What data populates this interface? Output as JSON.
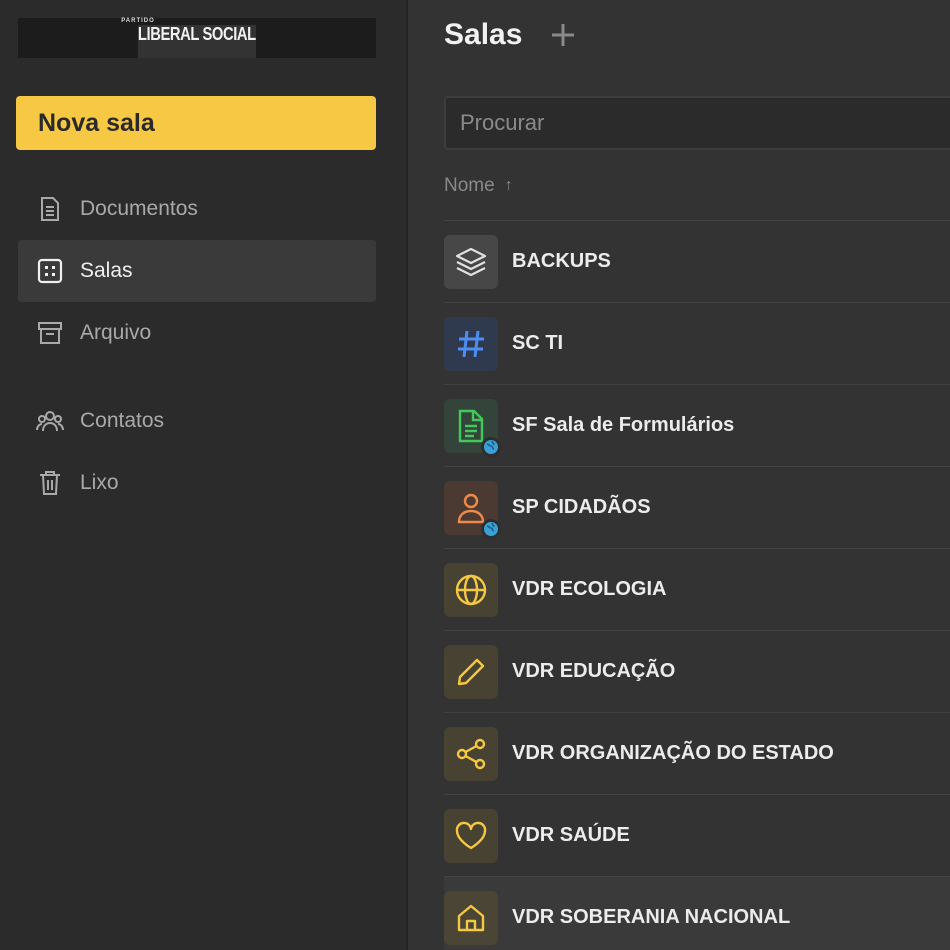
{
  "logo": {
    "top": "PARTIDO",
    "main": "LIBERAL SOCIAL"
  },
  "sidebar": {
    "new_room_label": "Nova sala",
    "items": [
      {
        "label": "Documentos",
        "icon": "document-icon"
      },
      {
        "label": "Salas",
        "icon": "rooms-grid-icon",
        "active": true
      },
      {
        "label": "Arquivo",
        "icon": "archive-icon"
      },
      {
        "label": "Contatos",
        "icon": "contacts-icon"
      },
      {
        "label": "Lixo",
        "icon": "trash-icon"
      }
    ]
  },
  "main": {
    "title": "Salas",
    "search_placeholder": "Procurar",
    "column_header": "Nome",
    "sort_arrow": "↑",
    "rooms": [
      {
        "name": "BACKUPS",
        "icon": "layers-icon",
        "color": "#e0e0e0"
      },
      {
        "name": "SC TI",
        "icon": "hash-icon",
        "color": "#4d8ef0"
      },
      {
        "name": "SF Sala de Formulários",
        "icon": "form-document-icon",
        "color": "#43c85a",
        "public": true
      },
      {
        "name": "SP CIDADÃOS",
        "icon": "person-icon",
        "color": "#f08a4b",
        "public": true
      },
      {
        "name": "VDR ECOLOGIA",
        "icon": "globe-icon",
        "color": "#f5c842"
      },
      {
        "name": "VDR EDUCAÇÃO",
        "icon": "pencil-icon",
        "color": "#f5c842"
      },
      {
        "name": "VDR ORGANIZAÇÃO DO ESTADO",
        "icon": "share-icon",
        "color": "#f5c842"
      },
      {
        "name": "VDR SAÚDE",
        "icon": "heart-icon",
        "color": "#f5c842"
      },
      {
        "name": "VDR SOBERANIA NACIONAL",
        "icon": "home-icon",
        "color": "#f5c842"
      }
    ]
  },
  "colors": {
    "accent": "#f7c844",
    "sidebar_bg": "#2b2b2b",
    "main_bg": "#333333"
  }
}
